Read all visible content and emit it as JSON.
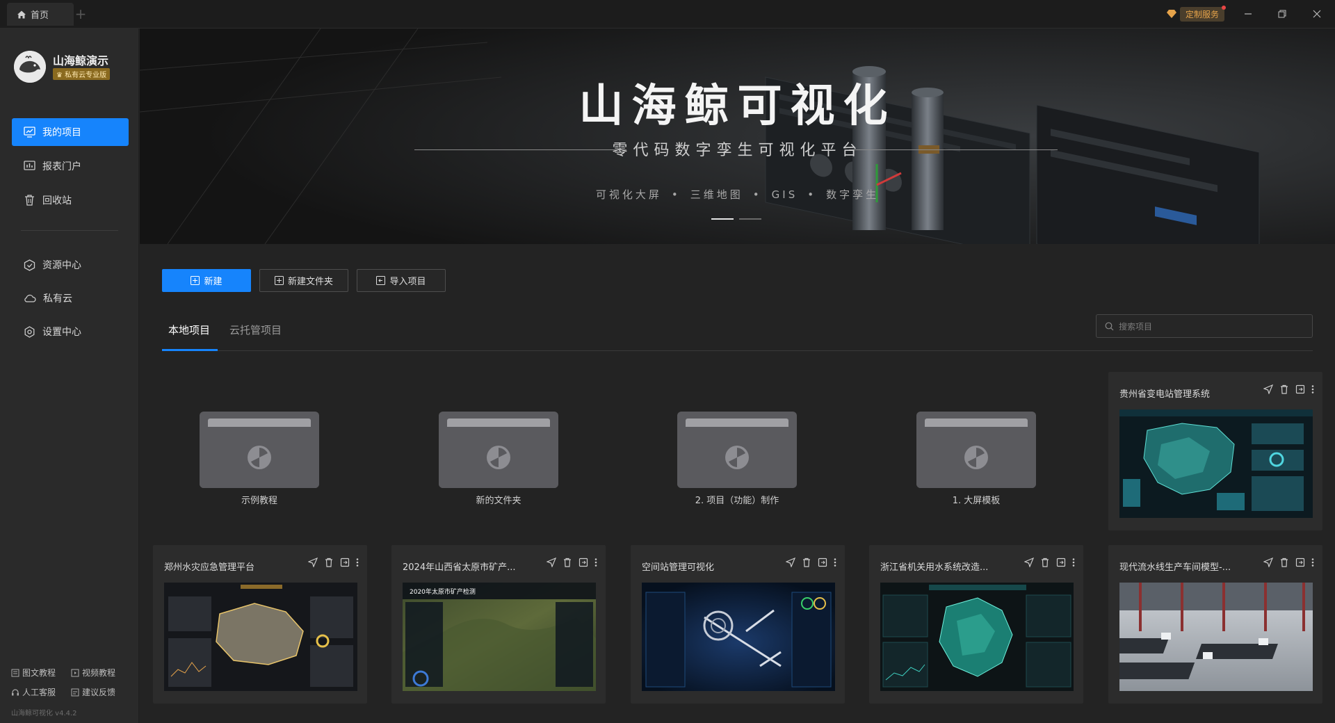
{
  "titlebar": {
    "home_tab": "首页",
    "service_label": "定制服务"
  },
  "user": {
    "name": "山海鲸演示",
    "edition": "私有云专业版"
  },
  "sidebar": {
    "items": [
      {
        "label": "我的项目",
        "icon": "monitor-icon",
        "active": true
      },
      {
        "label": "报表门户",
        "icon": "report-icon"
      },
      {
        "label": "回收站",
        "icon": "trash-icon"
      },
      {
        "label": "资源中心",
        "icon": "cube-icon"
      },
      {
        "label": "私有云",
        "icon": "cloud-icon"
      },
      {
        "label": "设置中心",
        "icon": "gear-icon"
      }
    ],
    "footer": {
      "text_tutorial": "图文教程",
      "video_tutorial": "视频教程",
      "support": "人工客服",
      "feedback": "建议反馈",
      "version": "山海鲸可视化 v4.4.2"
    }
  },
  "banner": {
    "title": "山海鲸可视化",
    "subtitle": "零代码数字孪生可视化平台",
    "tags": [
      "可视化大屏",
      "三维地图",
      "GIS",
      "数字孪生"
    ],
    "active_slide": 1,
    "slide_count": 2
  },
  "toolbar": {
    "new_label": "新建",
    "new_folder_label": "新建文件夹",
    "import_label": "导入项目"
  },
  "tabs": {
    "local": "本地项目",
    "cloud": "云托管项目"
  },
  "search": {
    "placeholder": "搜索项目"
  },
  "folders": [
    {
      "name": "示例教程"
    },
    {
      "name": "新的文件夹"
    },
    {
      "name": "2. 项目（功能）制作"
    },
    {
      "name": "1. 大屏模板"
    }
  ],
  "projects": [
    {
      "title": "贵州省变电站管理系统",
      "thumb": "map-teal"
    },
    {
      "title": "郑州水灾应急管理平台",
      "thumb": "map-gold"
    },
    {
      "title": "2024年山西省太原市矿产...",
      "thumb": "terrain",
      "thumb_heading": "2020年太原市矿产检测"
    },
    {
      "title": "空间站管理可视化",
      "thumb": "space"
    },
    {
      "title": "浙江省机关用水系统改造...",
      "thumb": "map-teal2"
    },
    {
      "title": "现代流水线生产车间模型-...",
      "thumb": "factory"
    }
  ],
  "colors": {
    "accent": "#1684fc",
    "service": "#e6a34a",
    "edition_badge": "#8a6a1f"
  }
}
